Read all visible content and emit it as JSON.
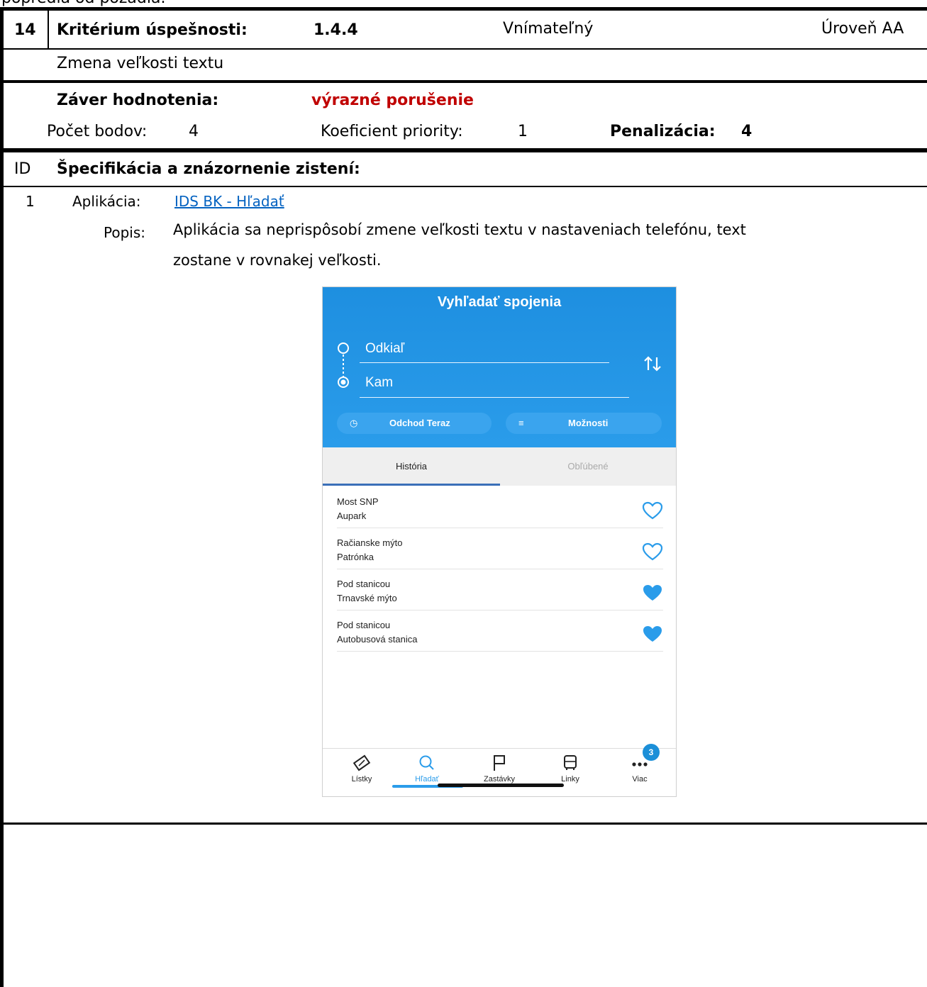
{
  "top_text": "popredia od pozadia.",
  "row1": {
    "number": "14",
    "criterion_label": "Kritérium úspešnosti:",
    "criterion_id": "1.4.4",
    "principle": "Vnímateľný",
    "level": "Úroveň AA"
  },
  "row2": {
    "criterion_name": "Zmena veľkosti textu"
  },
  "row3": {
    "conclusion_label": "Záver hodnotenia:",
    "conclusion_value": "výrazné porušenie",
    "conclusion_color": "#c00000"
  },
  "row4": {
    "points_label": "Počet bodov:",
    "points_value": "4",
    "priority_label": "Koeficient priority:",
    "priority_value": "1",
    "penalty_label": "Penalizácia:",
    "penalty_value": "4"
  },
  "row5": {
    "id_label": "ID",
    "spec_label": "Špecifikácia a znázornenie zistení:"
  },
  "finding": {
    "id": "1",
    "app_label": "Aplikácia:",
    "app_link": "IDS BK - Hľadať",
    "desc_label": "Popis:",
    "desc_line1": "Aplikácia sa neprispôsobí zmene veľkosti textu v nastaveniach telefónu, text",
    "desc_line2": "zostane v rovnakej veľkosti."
  },
  "phone": {
    "accent": "#2a9cea",
    "title": "Vyhľadať spojenia",
    "from_placeholder": "Odkiaľ",
    "to_placeholder": "Kam",
    "departure_button": "Odchod Teraz",
    "options_button": "Možnosti",
    "tabs": [
      "História",
      "Obľúbené"
    ],
    "history": [
      {
        "from": "Most SNP",
        "to": "Aupark",
        "favorite": false
      },
      {
        "from": "Račianske mýto",
        "to": "Patrónka",
        "favorite": false
      },
      {
        "from": "Pod stanicou",
        "to": "Trnavské mýto",
        "favorite": true
      },
      {
        "from": "Pod stanicou",
        "to": "Autobusová stanica",
        "favorite": true
      }
    ],
    "nav": [
      {
        "label": "Lístky",
        "icon": "ticket-icon"
      },
      {
        "label": "Hľadať",
        "icon": "search-icon"
      },
      {
        "label": "Zastávky",
        "icon": "flag-icon"
      },
      {
        "label": "Linky",
        "icon": "bus-icon"
      },
      {
        "label": "Viac",
        "icon": "more-icon"
      }
    ],
    "more_badge": "3"
  }
}
